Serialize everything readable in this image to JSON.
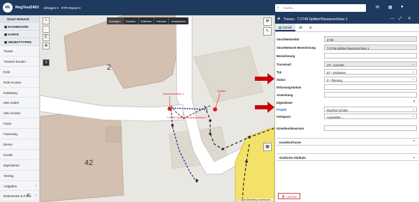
{
  "header": {
    "logo": "ME",
    "app_name": "RegTest2403",
    "menu": [
      "Abfragen ▾",
      "RTR Report ▾"
    ],
    "search_placeholder": "Suche..."
  },
  "sidebar": {
    "title": "Smart Network",
    "sections": [
      {
        "label": "DASHBOARD",
        "icon": "dashboard-icon"
      },
      {
        "label": "KARTE",
        "icon": "map-icon"
      },
      {
        "label": "OBJEKTTYPEN",
        "icon": "objecttypes-icon"
      }
    ],
    "items": [
      "Trasse",
      "Trassen-Knoten",
      "Rohr",
      "Rohr-Knoten",
      "Kabelweg",
      "LWL-Kabel",
      "LWL-Knoten",
      "Faser",
      "Faserweg",
      "Dienst",
      "Kunde",
      "Eigentümer",
      "Vertrag",
      "Aufgaben",
      "Dokumente & Fotos"
    ],
    "expandable": [
      "Aufgaben",
      "Dokumente & Fotos"
    ],
    "collapse": "«"
  },
  "map": {
    "toolbar": [
      "Anzeigen",
      "Drucken",
      "Editieren",
      "Messen",
      "Analysieren"
    ],
    "active_tool": "Anzeigen",
    "controls": [
      "+",
      "-",
      "E",
      "⊕"
    ],
    "building_labels": [
      "2",
      "42"
    ],
    "annotations": {
      "hausanschluss": "Hausanschluss 1",
      "splitter": "Splitter",
      "trasse": "T-2749-Splitter/Hausanschluss 1"
    },
    "attribution": "© OpenStreetMap contributors."
  },
  "panel": {
    "title": "Trasse - T-2749-Splitter/Hausanschluss 1",
    "tabs": [
      "Details",
      "",
      ""
    ],
    "fields": [
      {
        "label": "SmartNetworkID",
        "value": "2749",
        "readonly": true,
        "dropdown": false
      },
      {
        "label": "SmartNetwork-Bezeichnung",
        "value": "T-2749-Splitter/Hausanschluss 1",
        "readonly": true,
        "dropdown": false
      },
      {
        "label": "Bezeichnung",
        "value": "",
        "readonly": false,
        "dropdown": false
      },
      {
        "label": "Trassenart",
        "value": "LR - Leerrohr",
        "readonly": true,
        "dropdown": true
      },
      {
        "label": "Typ",
        "value": "ET - Erdtrasse",
        "readonly": false,
        "dropdown": true
      },
      {
        "label": "Status",
        "value": "P - Planung",
        "readonly": false,
        "dropdown": true
      },
      {
        "label": "Erfassungsdatum",
        "value": "",
        "readonly": false,
        "dropdown": false
      },
      {
        "label": "Anmerkung",
        "value": "",
        "readonly": false,
        "dropdown": false
      },
      {
        "label": "Eigentümer",
        "value": "",
        "readonly": false,
        "dropdown": false
      },
      {
        "label": "Projekt",
        "value": "RegTest Schiller",
        "readonly": false,
        "dropdown": true
      },
      {
        "label": "Verlegeart",
        "value": "Auswählen ...",
        "readonly": false,
        "dropdown": true
      }
    ],
    "kuenettendimension": "Künettendimension",
    "sections": [
      "Kunden4Trasse",
      "Grafische Attribute"
    ],
    "delete_button": "Löschen"
  },
  "colors": {
    "header": "#1f3a5f",
    "arrow_red": "#cc0000",
    "trasse": "#3a2a8a"
  }
}
